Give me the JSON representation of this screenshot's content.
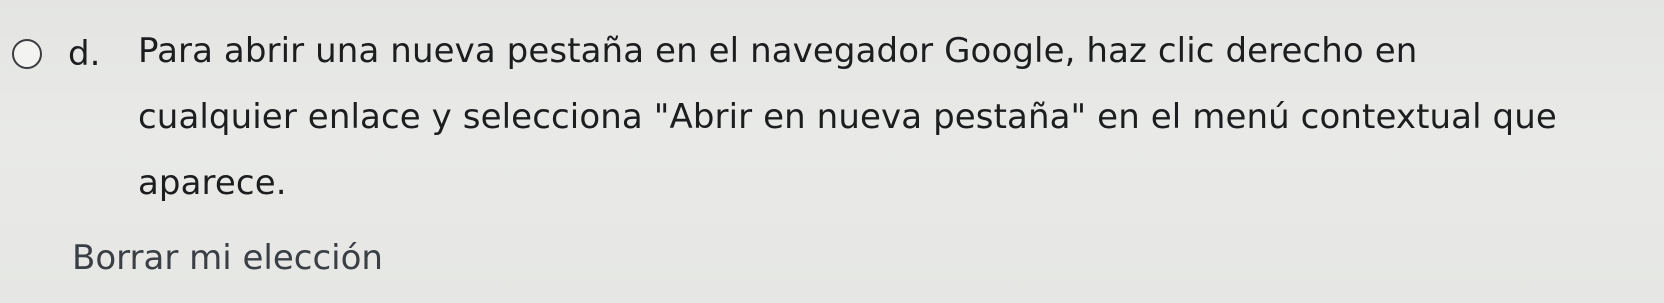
{
  "question": {
    "option_d": {
      "letter": "d.",
      "text_lines": [
        "Para abrir una nueva pestaña en el navegador Google, haz clic derecho en",
        "cualquier enlace y selecciona \"Abrir en nueva pestaña\" en el menú contextual que",
        "aparece."
      ],
      "selected": false
    },
    "clear_choice_label": "Borrar mi elección"
  }
}
